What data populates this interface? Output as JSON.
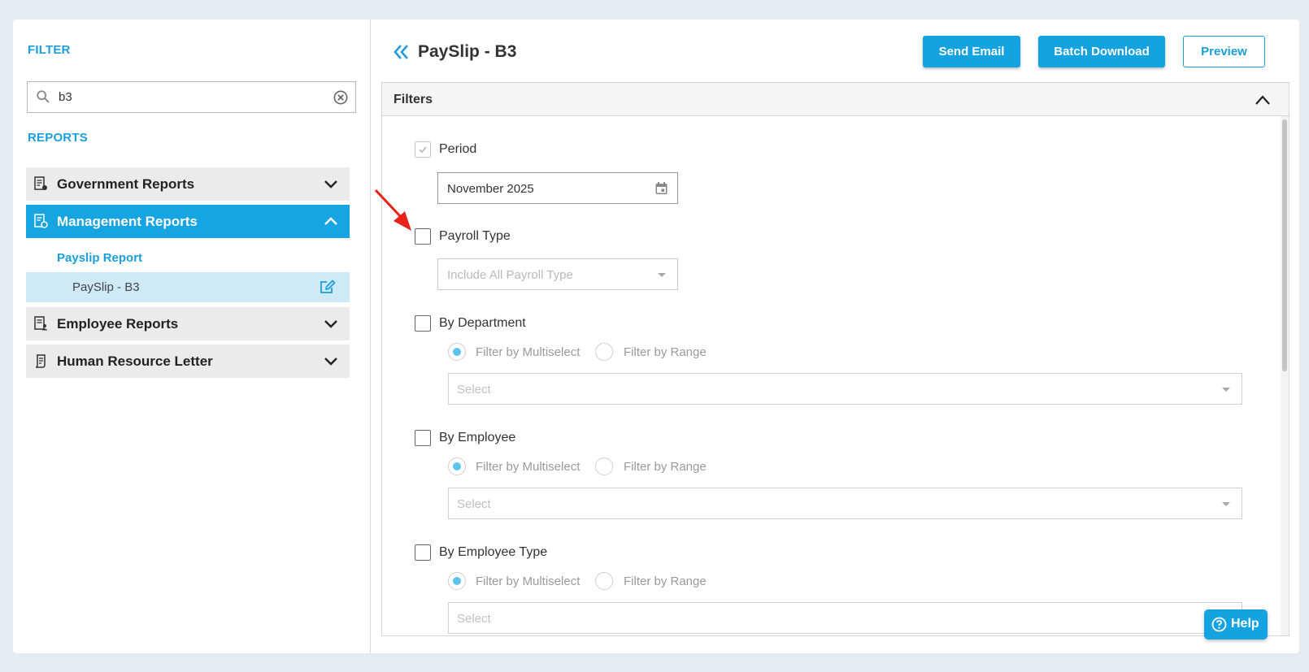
{
  "sidebar": {
    "filter_title": "FILTER",
    "search": {
      "value": "b3"
    },
    "reports_title": "REPORTS",
    "groups": [
      {
        "label": "Government Reports",
        "expanded": false
      },
      {
        "label": "Management Reports",
        "expanded": true
      },
      {
        "label": "Employee Reports",
        "expanded": false
      },
      {
        "label": "Human Resource Letter",
        "expanded": false
      }
    ],
    "subgroup": {
      "title": "Payslip Report",
      "item": "PaySlip - B3"
    }
  },
  "header": {
    "title": "PaySlip - B3",
    "buttons": {
      "send_email": "Send Email",
      "batch_download": "Batch Download",
      "preview": "Preview"
    }
  },
  "filters": {
    "title": "Filters",
    "period": {
      "label": "Period",
      "checked": true,
      "value": "November 2025"
    },
    "payroll_type": {
      "label": "Payroll Type",
      "checked": false,
      "placeholder": "Include All Payroll Type"
    },
    "by_department": {
      "label": "By Department",
      "checked": false
    },
    "by_employee": {
      "label": "By Employee",
      "checked": false
    },
    "by_employee_type": {
      "label": "By Employee Type",
      "checked": false
    },
    "radio_multiselect": "Filter by Multiselect",
    "radio_range": "Filter by Range",
    "select_placeholder": "Select"
  },
  "help": {
    "label": "Help"
  },
  "colors": {
    "accent": "#14a3e0",
    "active_row": "#cfeaf7",
    "annotation_arrow": "#e8221b"
  }
}
